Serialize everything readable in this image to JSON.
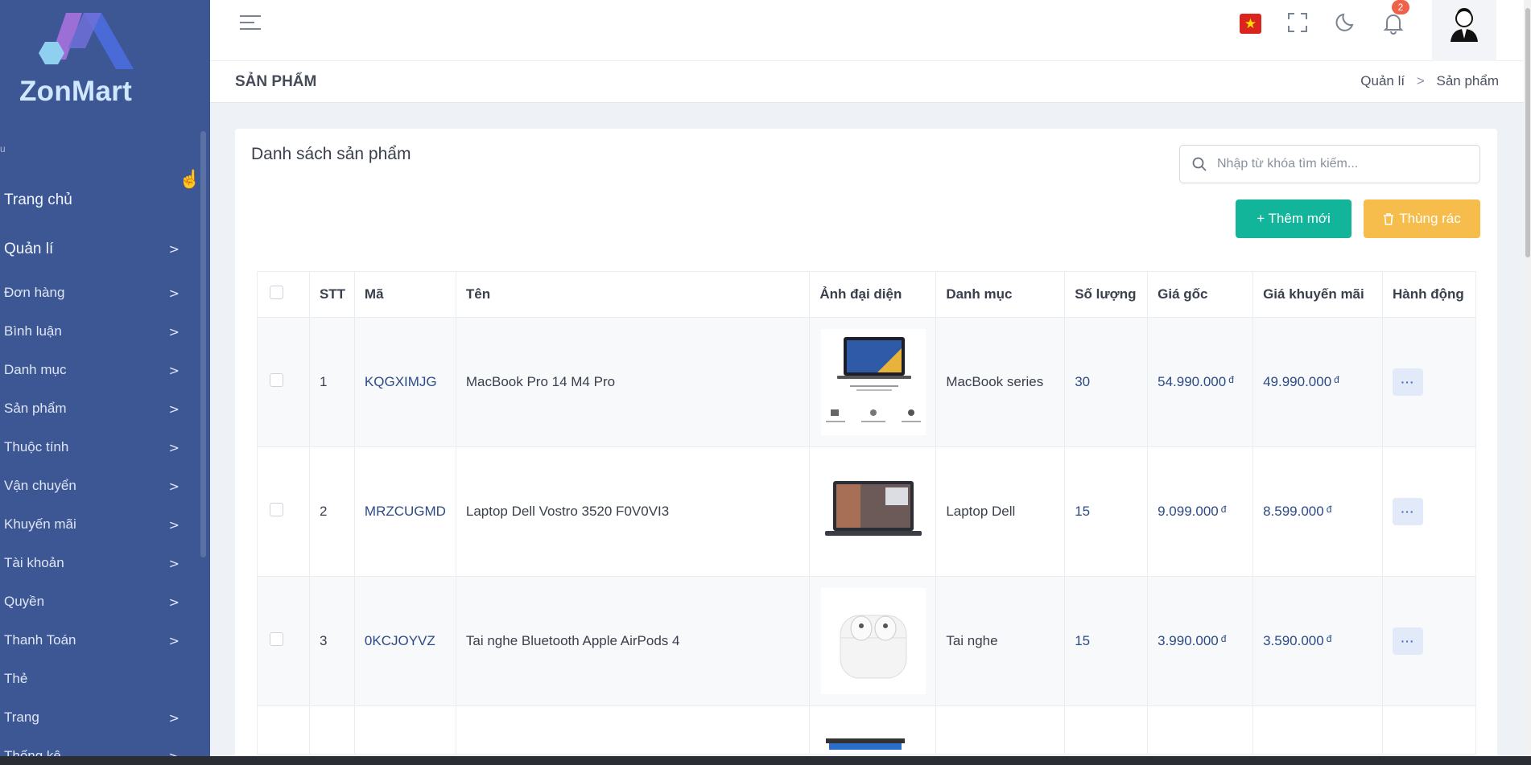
{
  "brand": {
    "name": "ZonMart"
  },
  "sidebar": {
    "caption": "u",
    "home": "Trang chủ",
    "section": "Quản lí",
    "items": [
      {
        "label": "Đơn hàng",
        "has_children": true
      },
      {
        "label": "Bình luận",
        "has_children": true
      },
      {
        "label": "Danh mục",
        "has_children": true
      },
      {
        "label": "Sản phẩm",
        "has_children": true
      },
      {
        "label": "Thuộc tính",
        "has_children": true
      },
      {
        "label": "Vận chuyển",
        "has_children": true
      },
      {
        "label": "Khuyến mãi",
        "has_children": true
      },
      {
        "label": "Tài khoản",
        "has_children": true
      },
      {
        "label": "Quyền",
        "has_children": true
      },
      {
        "label": "Thanh Toán",
        "has_children": true
      },
      {
        "label": "Thẻ",
        "has_children": false
      },
      {
        "label": "Trang",
        "has_children": true
      },
      {
        "label": "Thống kê",
        "has_children": true
      }
    ],
    "chevron": ">"
  },
  "topbar": {
    "notification_count": "2",
    "icons": [
      "menu-icon",
      "vietnam-flag-icon",
      "fullscreen-icon",
      "moon-icon",
      "bell-icon",
      "user-avatar"
    ]
  },
  "page": {
    "title": "SẢN PHẨM",
    "breadcrumb": [
      "Quản lí",
      "Sản phẩm"
    ],
    "breadcrumb_sep": ">"
  },
  "card": {
    "title": "Danh sách sản phẩm",
    "search_placeholder": "Nhập từ khóa tìm kiếm...",
    "add_button": "+ Thêm mới",
    "trash_button": "Thùng rác"
  },
  "table": {
    "headers": [
      "STT",
      "Mã",
      "Tên",
      "Ảnh đại diện",
      "Danh mục",
      "Số lượng",
      "Giá gốc",
      "Giá khuyến mãi",
      "Hành động"
    ],
    "currency": "đ",
    "action_label": "···",
    "rows": [
      {
        "stt": "1",
        "code": "KQGXIMJG",
        "name": "MacBook Pro 14 M4 Pro",
        "image": "macbook",
        "category": "MacBook series",
        "qty": "30",
        "price": "54.990.000",
        "sale": "49.990.000"
      },
      {
        "stt": "2",
        "code": "MRZCUGMD",
        "name": "Laptop Dell Vostro 3520 F0V0VI3",
        "image": "dell",
        "category": "Laptop Dell",
        "qty": "15",
        "price": "9.099.000",
        "sale": "8.599.000"
      },
      {
        "stt": "3",
        "code": "0KCJOYVZ",
        "name": "Tai nghe Bluetooth Apple AirPods 4",
        "image": "airpods",
        "category": "Tai nghe",
        "qty": "15",
        "price": "3.990.000",
        "sale": "3.590.000"
      }
    ]
  },
  "colors": {
    "sidebar_bg": "#3d5795",
    "add_button": "#13b59a",
    "trash_button": "#f6bd4c",
    "badge": "#f0614a"
  }
}
